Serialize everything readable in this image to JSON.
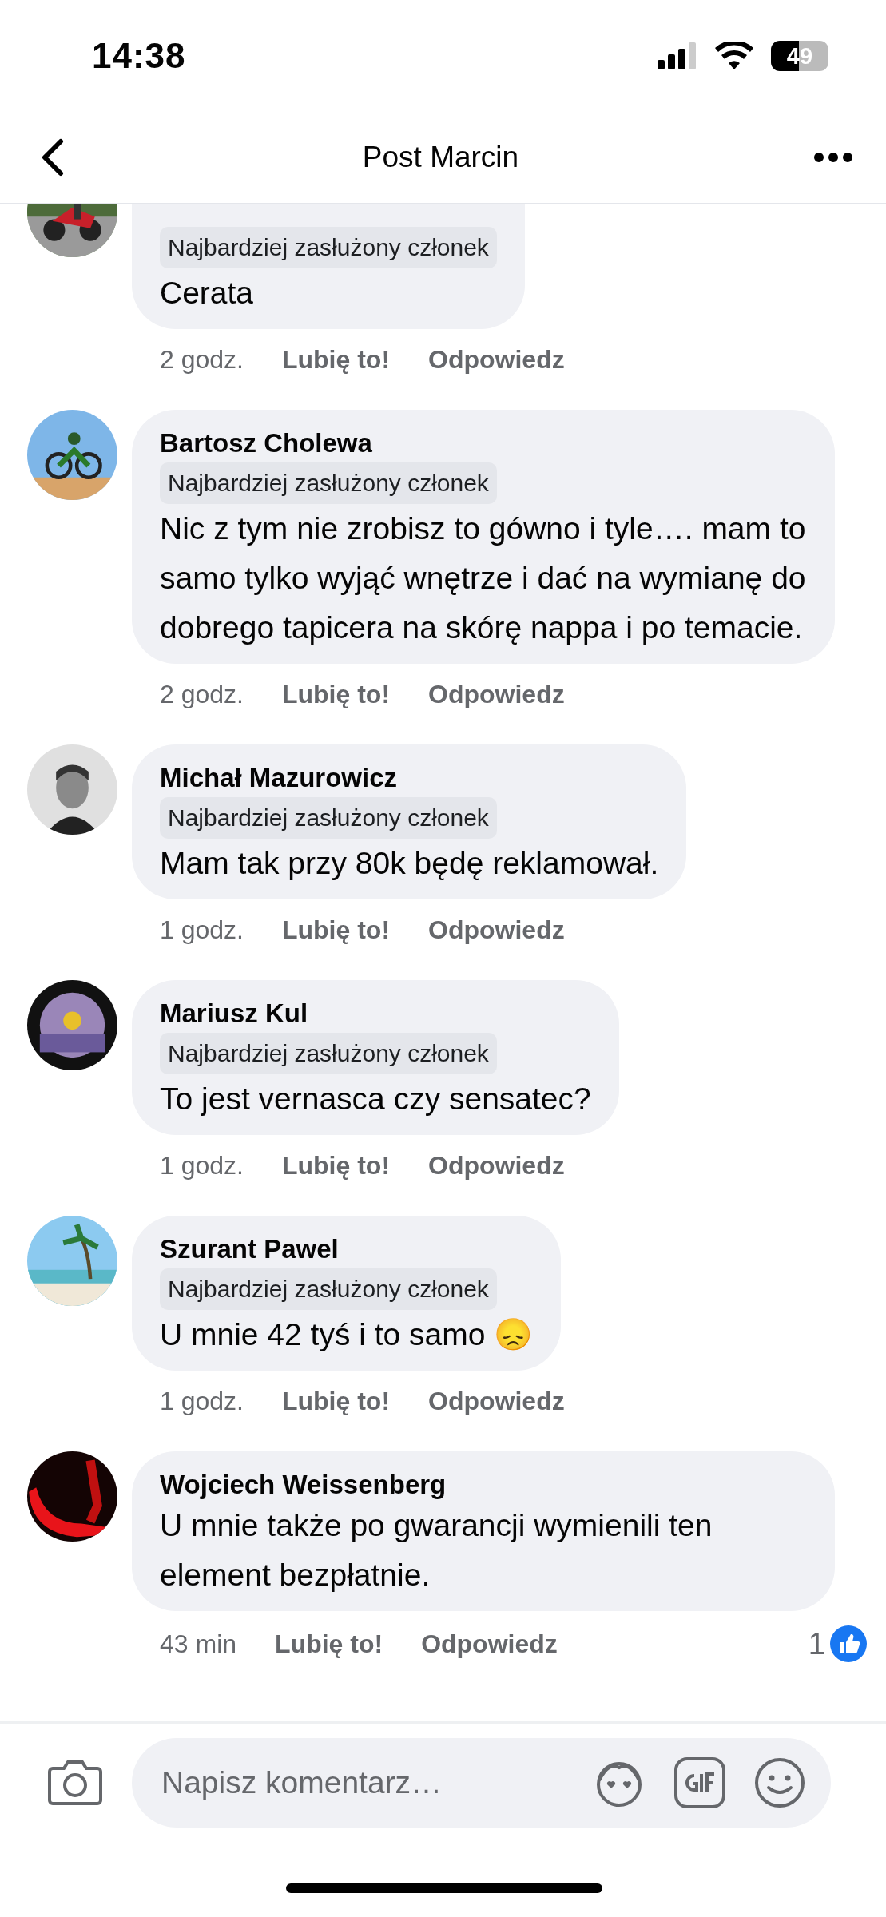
{
  "status_bar": {
    "time": "14:38",
    "battery": "49"
  },
  "header": {
    "title": "Post Marcin"
  },
  "comments": [
    {
      "badge": "Najbardziej zasłużony członek",
      "text": "Cerata",
      "time": "2 godz.",
      "like": "Lubię to!",
      "reply": "Odpowiedz"
    },
    {
      "name": "Bartosz Cholewa",
      "badge": "Najbardziej zasłużony członek",
      "text": "Nic z tym nie zrobisz to gówno i tyle…. mam to samo tylko wyjąć wnętrze i dać na wymianę do dobrego tapicera na skórę nappa i po temacie.",
      "time": "2 godz.",
      "like": "Lubię to!",
      "reply": "Odpowiedz"
    },
    {
      "name": "Michał Mazurowicz",
      "badge": "Najbardziej zasłużony członek",
      "text": "Mam tak przy 80k będę reklamował.",
      "time": "1 godz.",
      "like": "Lubię to!",
      "reply": "Odpowiedz"
    },
    {
      "name": "Mariusz Kul",
      "badge": "Najbardziej zasłużony członek",
      "text": "To jest vernasca czy sensatec?",
      "time": "1 godz.",
      "like": "Lubię to!",
      "reply": "Odpowiedz"
    },
    {
      "name": "Szurant Pawel",
      "badge": "Najbardziej zasłużony członek",
      "text": "U mnie 42 tyś i to samo 😞",
      "time": "1 godz.",
      "like": "Lubię to!",
      "reply": "Odpowiedz"
    },
    {
      "name": "Wojciech Weissenberg",
      "text": "U mnie także po gwarancji wymienili ten element bezpłatnie.",
      "time": "43 min",
      "like": "Lubię to!",
      "reply": "Odpowiedz",
      "reactions": "1"
    }
  ],
  "composer": {
    "placeholder": "Napisz komentarz…"
  }
}
